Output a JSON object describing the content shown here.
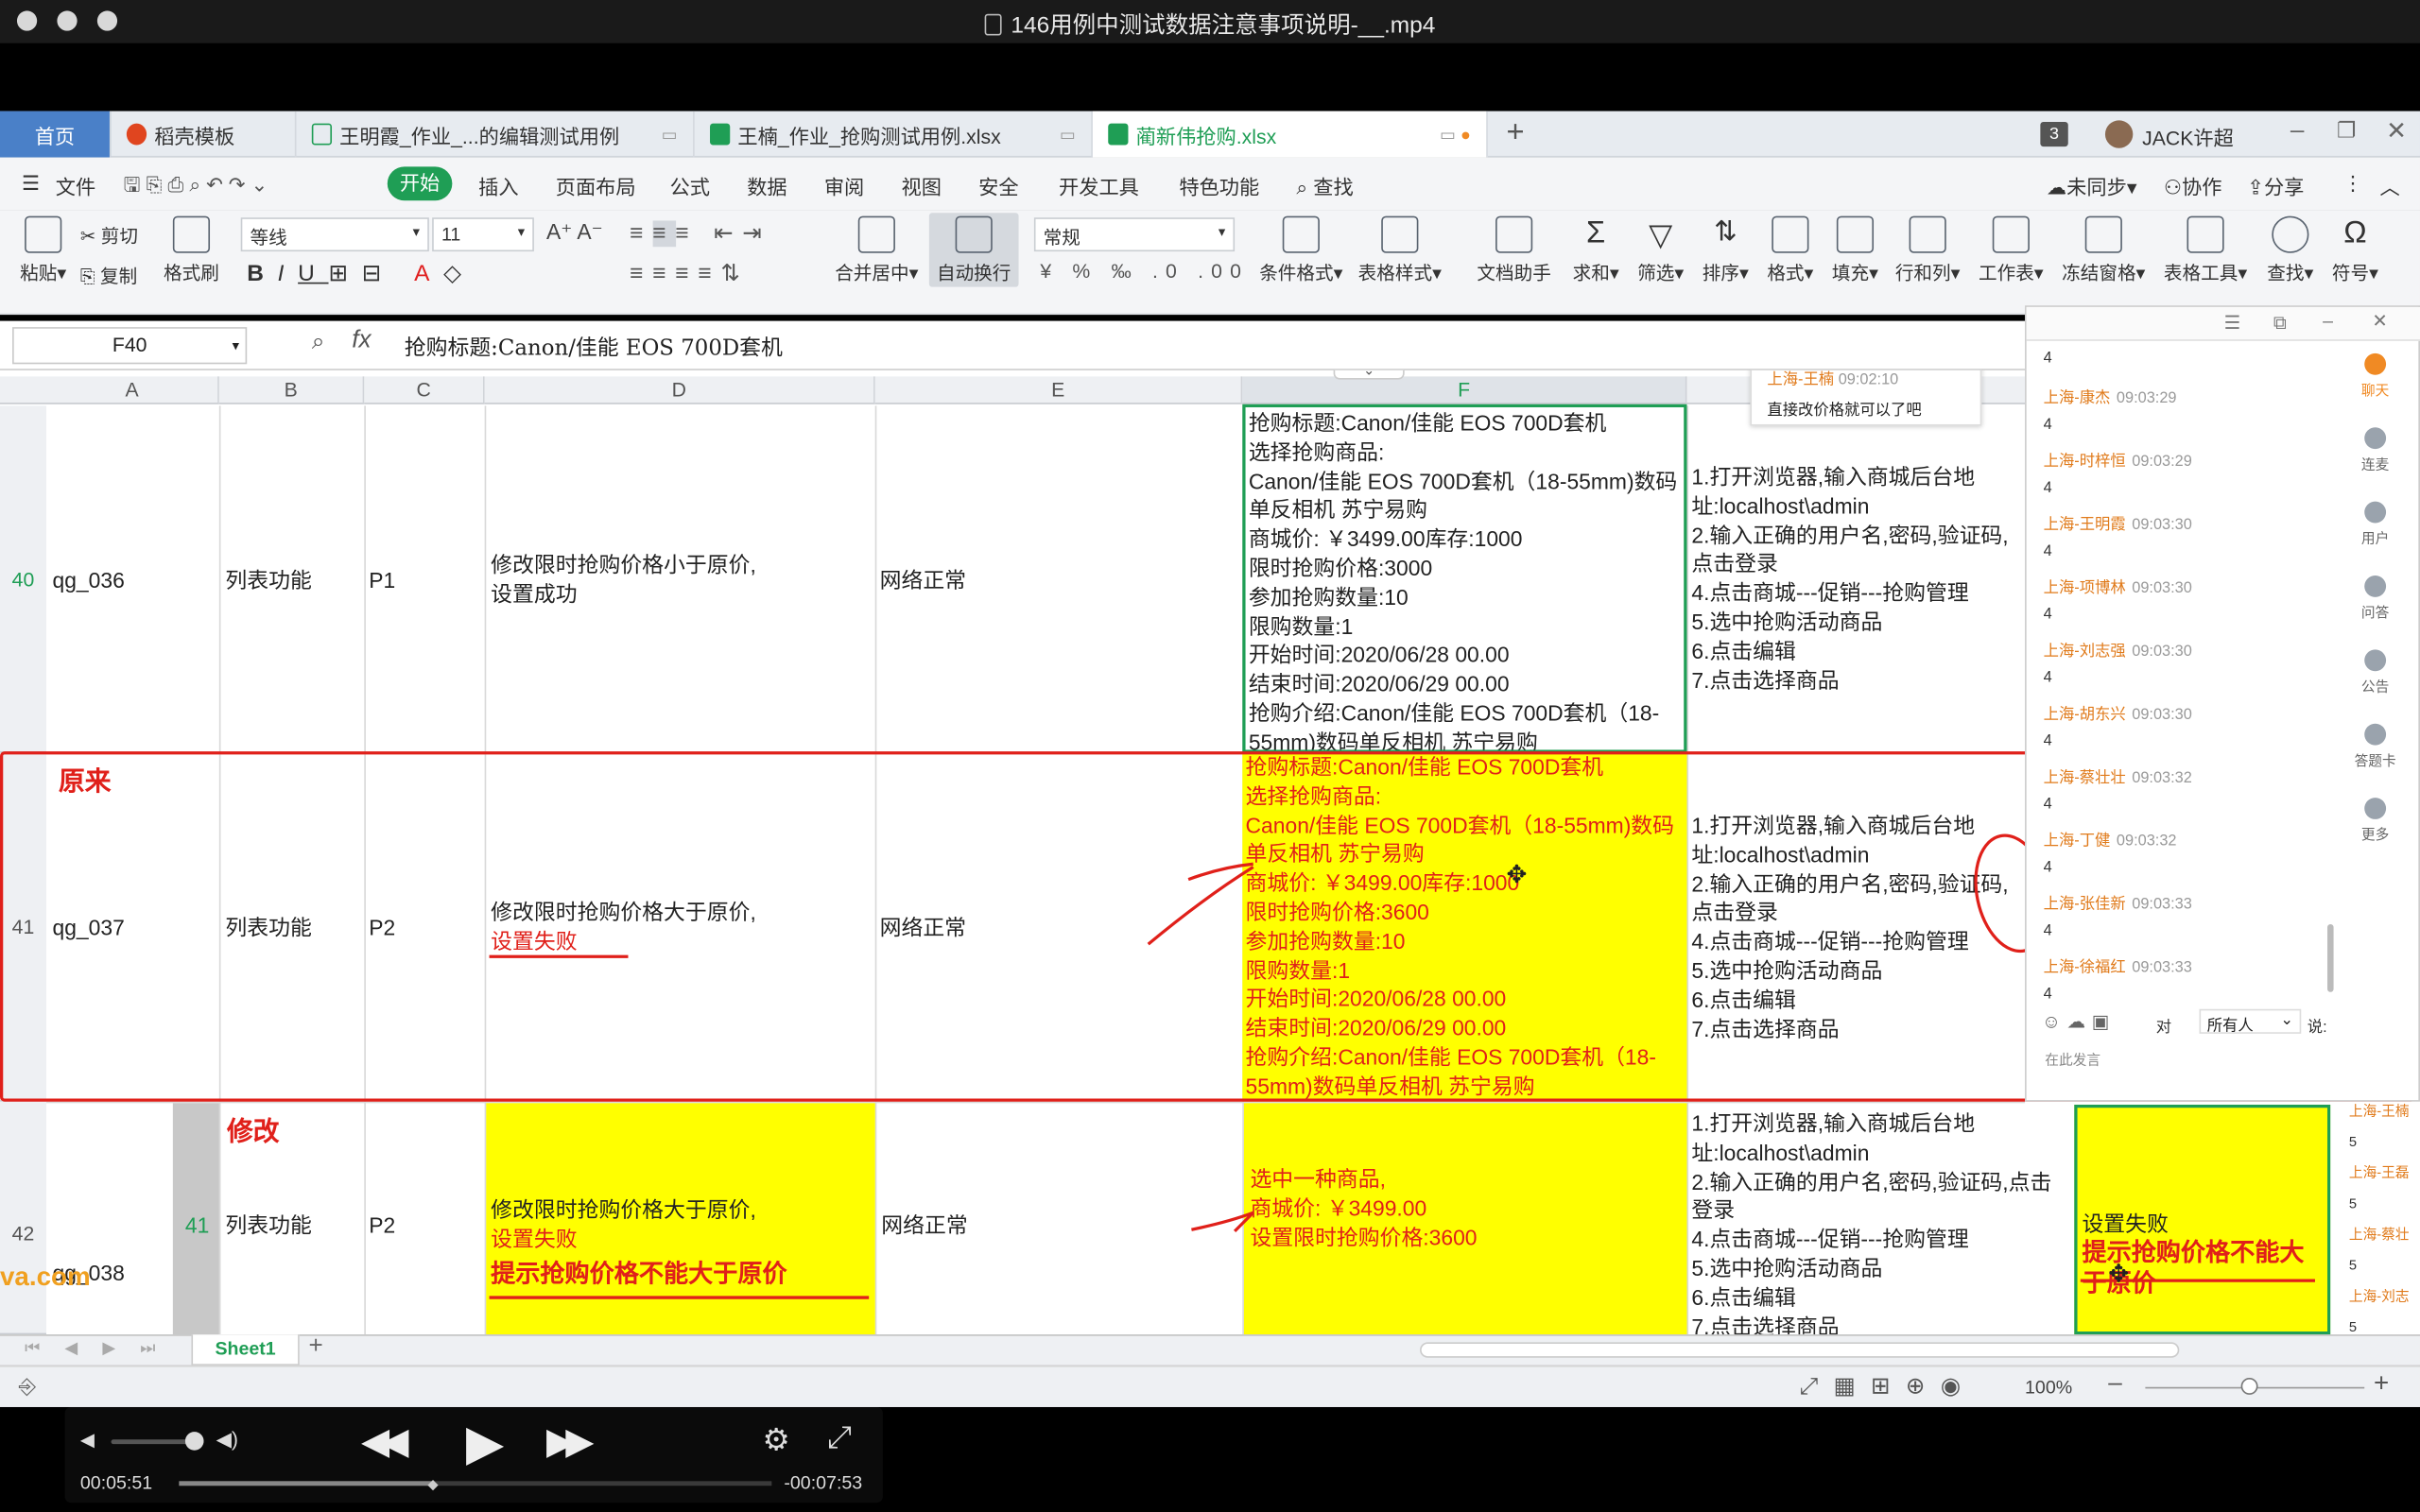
{
  "window": {
    "title": "146用例中测试数据注意事项说明-__.mp4"
  },
  "tabs": {
    "home": "首页",
    "t1": "稻壳模板",
    "t2": "王明霞_作业_...的编辑测试用例",
    "t3": "王楠_作业_抢购测试用例.xlsx",
    "t4": "蔺新伟抢购.xlsx",
    "add": "+",
    "badge": "3",
    "user": "JACK许超"
  },
  "menu": {
    "file": "文件",
    "start": "开始",
    "insert": "插入",
    "layout": "页面布局",
    "formula": "公式",
    "data": "数据",
    "review": "审阅",
    "view": "视图",
    "security": "安全",
    "dev": "开发工具",
    "special": "特色功能",
    "find": "查找",
    "sync": "未同步",
    "collab": "协作",
    "share": "分享"
  },
  "ribbon": {
    "paste": "粘贴",
    "cut": "剪切",
    "copy": "复制",
    "format_painter": "格式刷",
    "font": "等线",
    "size": "11",
    "merge": "合并居中",
    "wrap": "自动换行",
    "numfmt": "常规",
    "cond": "条件格式",
    "tablestyle": "表格样式",
    "assist": "文档助手",
    "sum": "求和",
    "filter": "筛选",
    "sort": "排序",
    "format": "格式",
    "fill": "填充",
    "rowcol": "行和列",
    "sheet": "工作表",
    "freeze": "冻结窗格",
    "tabletool": "表格工具",
    "find": "查找",
    "symbol": "符号"
  },
  "formula_bar": {
    "cell": "F40",
    "fx": "fx",
    "content": "抢购标题:Canon/佳能 EOS 700D套机"
  },
  "columns": [
    "A",
    "B",
    "C",
    "D",
    "E",
    "F"
  ],
  "rows": {
    "r40": {
      "num": "40",
      "id": "qg_036",
      "module": "列表功能",
      "priority": "P1",
      "title": "修改限时抢购价格小于原价,\n设置成功",
      "env": "网络正常",
      "data": "抢购标题:Canon/佳能 EOS 700D套机\n选择抢购商品:\nCanon/佳能 EOS 700D套机（18-55mm)数码单反相机 苏宁易购\n商城价: ￥3499.00库存:1000\n限时抢购价格:3000\n参加抢购数量:10\n限购数量:1\n开始时间:2020/06/28  00.00\n结束时间:2020/06/29  00.00\n抢购介绍:Canon/佳能 EOS 700D套机（18-55mm)数码单反相机 苏宁易购",
      "steps": "1.打开浏览器,输入商城后台地址:localhost\\admin\n2.输入正确的用户名,密码,验证码,点击登录\n4.点击商城---促销---抢购管理\n5.选中抢购活动商品\n6.点击编辑\n7.点击选择商品"
    },
    "r41": {
      "num": "41",
      "id": "qg_037",
      "module": "列表功能",
      "priority": "P2",
      "title1": "修改限时抢购价格大于原价,",
      "title2": "设置失败",
      "env": "网络正常",
      "data": "抢购标题:Canon/佳能 EOS 700D套机\n选择抢购商品:\nCanon/佳能 EOS 700D套机（18-55mm)数码单反相机 苏宁易购\n商城价: ￥3499.00库存:1000\n限时抢购价格:3600\n参加抢购数量:10\n限购数量:1\n开始时间:2020/06/28  00.00\n结束时间:2020/06/29  00.00\n抢购介绍:Canon/佳能 EOS 700D套机（18-55mm)数码单反相机 苏宁易购",
      "steps": "1.打开浏览器,输入商城后台地址:localhost\\admin\n2.输入正确的用户名,密码,验证码,点击登录\n4.点击商城---促销---抢购管理\n5.选中抢购活动商品\n6.点击编辑\n7.点击选择商品"
    },
    "r42": {
      "num": "42",
      "id": "qg_038",
      "inner_num": "41",
      "module": "列表功能",
      "priority": "P2",
      "title1": "修改限时抢购价格大于原价,",
      "title2": "设置失败",
      "title3": "提示抢购价格不能大于原价",
      "env": "网络正常",
      "data": "选中一种商品,\n商城价: ￥3499.00\n设置限时抢购价格:3600",
      "steps": "1.打开浏览器,输入商城后台地址:localhost\\admin\n2.输入正确的用户名,密码,验证码,点击登录\n4.点击商城---促销---抢购管理\n5.选中抢购活动商品\n6.点击编辑\n7.点击选择商品",
      "result1": "设置失败",
      "result2": "提示抢购价格不能大于原价"
    }
  },
  "annotations": {
    "original": "原来",
    "modified": "修改",
    "watermark": "va.com"
  },
  "comment": {
    "who": "上海-王楠",
    "time": "09:02:10",
    "text": "直接改价格就可以了吧"
  },
  "chat": {
    "messages": [
      {
        "who": "上海-康杰",
        "time": "09:03:29",
        "text": "4"
      },
      {
        "who": "上海-时梓恒",
        "time": "09:03:29",
        "text": "4"
      },
      {
        "who": "上海-王明霞",
        "time": "09:03:30",
        "text": "4"
      },
      {
        "who": "上海-项博林",
        "time": "09:03:30",
        "text": "4"
      },
      {
        "who": "上海-刘志强",
        "time": "09:03:30",
        "text": "4"
      },
      {
        "who": "上海-胡东兴",
        "time": "09:03:30",
        "text": "4"
      },
      {
        "who": "上海-蔡壮壮",
        "time": "09:03:32",
        "text": "4"
      },
      {
        "who": "上海-丁健",
        "time": "09:03:32",
        "text": "4"
      },
      {
        "who": "上海-张佳新",
        "time": "09:03:33",
        "text": "4"
      },
      {
        "who": "上海-徐福红",
        "time": "09:03:33",
        "text": "4"
      }
    ],
    "first": "4",
    "to_label": "对",
    "to_value": "所有人",
    "say": "说:",
    "placeholder": "在此发言",
    "side": [
      "聊天",
      "连麦",
      "用户",
      "问答",
      "公告",
      "答题卡",
      "更多"
    ],
    "peek": [
      "上海-王楠",
      "5",
      "上海-王磊",
      "5",
      "上海-蔡壮",
      "5",
      "上海-刘志",
      "5"
    ]
  },
  "sheet": {
    "name": "Sheet1",
    "add": "+"
  },
  "status": {
    "zoom": "100%"
  },
  "player": {
    "elapsed": "00:05:51",
    "remaining": "-00:07:53",
    "progress": 0.43
  }
}
